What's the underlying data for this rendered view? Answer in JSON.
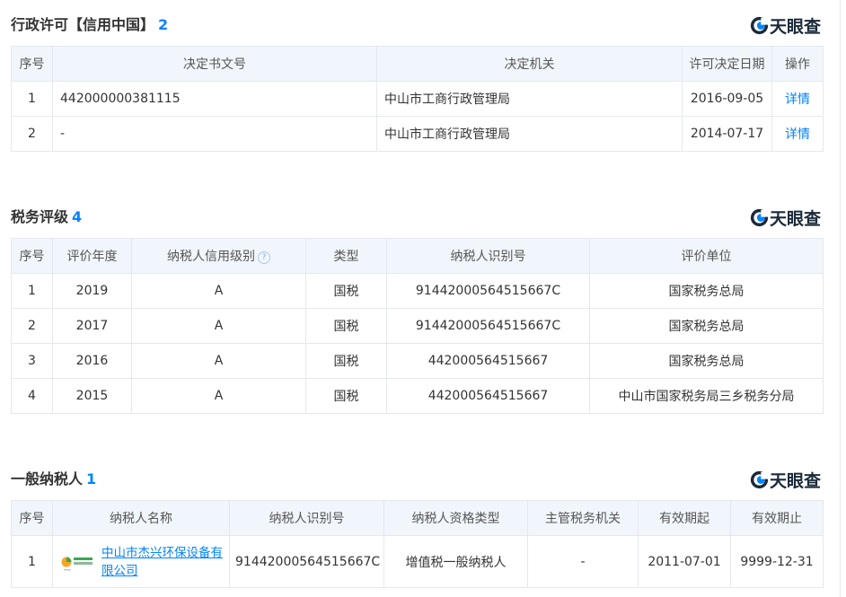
{
  "brand": {
    "name": "天眼查"
  },
  "colors": {
    "accent": "#0084ff",
    "header_bg": "#f1f6fc",
    "border": "#e4e8ee"
  },
  "sections": {
    "license": {
      "title": "行政许可【信用中国】",
      "count": "2",
      "headers": [
        "序号",
        "决定书文号",
        "决定机关",
        "许可决定日期",
        "操作"
      ],
      "rows": [
        {
          "no": "1",
          "doc": "442000000381115",
          "org": "中山市工商行政管理局",
          "date": "2016-09-05",
          "action": "详情"
        },
        {
          "no": "2",
          "doc": "-",
          "org": "中山市工商行政管理局",
          "date": "2014-07-17",
          "action": "详情"
        }
      ]
    },
    "tax": {
      "title": "税务评级",
      "count": "4",
      "headers": [
        "序号",
        "评价年度",
        "纳税人信用级别",
        "类型",
        "纳税人识别号",
        "评价单位"
      ],
      "help_icon": "?",
      "rows": [
        {
          "no": "1",
          "year": "2019",
          "level": "A",
          "type": "国税",
          "id": "91442000564515667C",
          "unit": "国家税务总局"
        },
        {
          "no": "2",
          "year": "2017",
          "level": "A",
          "type": "国税",
          "id": "91442000564515667C",
          "unit": "国家税务总局"
        },
        {
          "no": "3",
          "year": "2016",
          "level": "A",
          "type": "国税",
          "id": "442000564515667",
          "unit": "国家税务总局"
        },
        {
          "no": "4",
          "year": "2015",
          "level": "A",
          "type": "国税",
          "id": "442000564515667",
          "unit": "中山市国家税务局三乡税务分局"
        }
      ]
    },
    "general": {
      "title": "一般纳税人",
      "count": "1",
      "headers": [
        "序号",
        "纳税人名称",
        "纳税人识别号",
        "纳税人资格类型",
        "主管税务机关",
        "有效期起",
        "有效期止"
      ],
      "rows": [
        {
          "no": "1",
          "name": "中山市杰兴环保设备有限公司",
          "id": "91442000564515667C",
          "qual": "增值税一般纳税人",
          "authority": "-",
          "start": "2011-07-01",
          "end": "9999-12-31"
        }
      ]
    }
  }
}
